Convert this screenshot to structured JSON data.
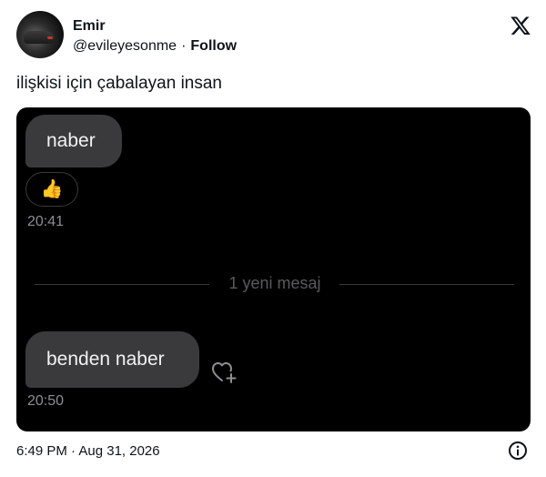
{
  "tweet": {
    "author": {
      "name": "Emir",
      "handle": "@evileyesonme",
      "separator": "·",
      "follow_label": "Follow",
      "avatar_icon": "avatar-car-photo"
    },
    "logo_icon": "x-logo-icon",
    "text": "ilişkisi için çabalayan insan",
    "footer": {
      "timestamp": "6:49 PM · Aug 31, 2026",
      "info_icon": "info-icon"
    }
  },
  "media": {
    "background": "#000000",
    "bubble_color": "#3a3a3c",
    "messages": [
      {
        "text": "naber",
        "time": "20:41",
        "reaction": "👍"
      },
      {
        "text": "benden naber",
        "time": "20:50",
        "action_icon": "heart-plus-icon"
      }
    ],
    "divider_text": "1 yeni mesaj"
  }
}
